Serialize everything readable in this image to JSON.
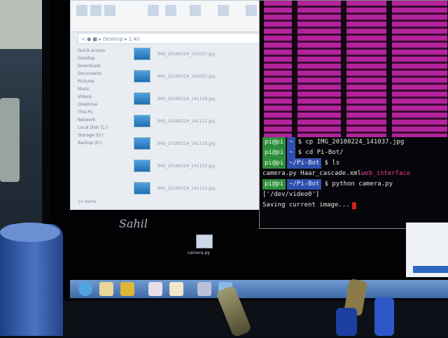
{
  "explorer": {
    "address": "<  ●  ■ ▸ Desktop ▸ 1.40",
    "nav_items": [
      "Quick access",
      "Desktop",
      "Downloads",
      "Documents",
      "Pictures",
      "Music",
      "Videos",
      "OneDrive",
      "This PC",
      "Network",
      "Local Disk (C:)",
      "Storage (D:)",
      "Backup (E:)"
    ],
    "files": [
      "IMG_20180224_141037.jpg",
      "IMG_20180224_141052.jpg",
      "IMG_20180224_141108.jpg",
      "IMG_20180224_141121.jpg",
      "IMG_20180224_141139.jpg",
      "IMG_20180224_141152.jpg",
      "IMG_20180224_141210.jpg"
    ],
    "status": "14 items"
  },
  "terminal": {
    "lines": [
      {
        "user": "pi@pi",
        "dir": "~",
        "cmd": "$ cp IMG_20180224_141037.jpg"
      },
      {
        "user": "pi@pi",
        "dir": "~",
        "cmd": "$ cd Pi-Bot/"
      },
      {
        "user": "pi@pi",
        "dir": "~/Pi-Bot",
        "cmd": "$ ls"
      },
      {
        "plain": "camera.py   Haar_cascade.xml   ",
        "highlight": "web_interface"
      },
      {
        "user": "pi@pi",
        "dir": "~/Pi-Bot",
        "cmd": "$ python camera.py"
      },
      {
        "plain": "['/dev/video0']"
      },
      {
        "plain": "Saving current image...",
        "cursor": true
      }
    ]
  },
  "desktop": {
    "signature": "Sahil",
    "icon_label": "camera.py"
  }
}
